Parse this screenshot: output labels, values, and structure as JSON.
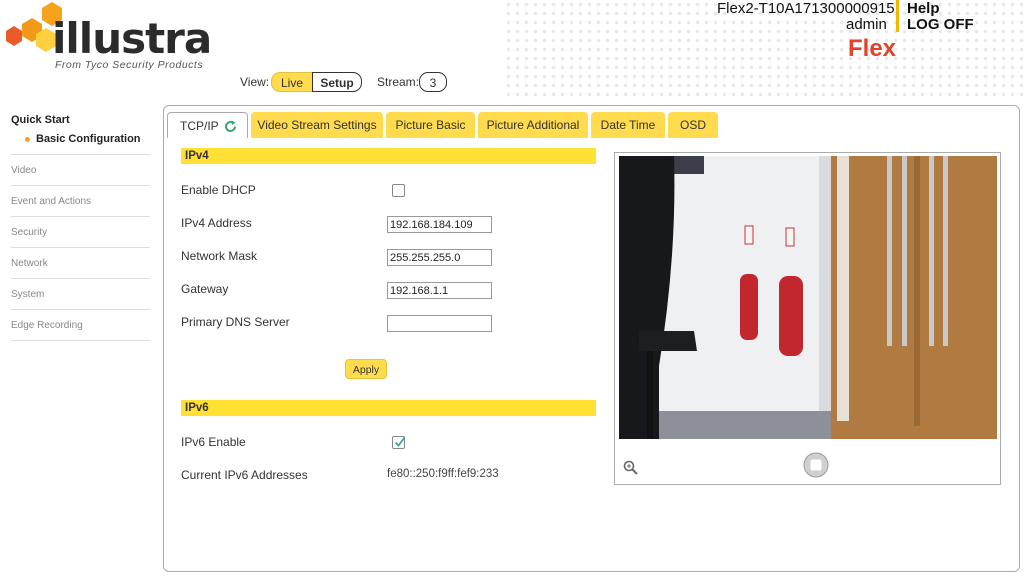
{
  "brand": {
    "logo_text": "illustra",
    "logo_sub": "From Tyco Security Products",
    "product": "Flex"
  },
  "header": {
    "device_name": "Flex2-T10A171300000915",
    "user": "admin",
    "help": "Help",
    "logoff": "LOG OFF"
  },
  "view": {
    "label": "View:",
    "live": "Live",
    "setup": "Setup",
    "stream_label": "Stream:",
    "stream_value": "3"
  },
  "sidebar": {
    "title": "Quick Start",
    "sub": "Basic Configuration",
    "items": [
      "Video",
      "Event and Actions",
      "Security",
      "Network",
      "System",
      "Edge Recording"
    ]
  },
  "tabs": [
    "TCP/IP",
    "Video Stream Settings",
    "Picture Basic",
    "Picture Additional",
    "Date Time",
    "OSD"
  ],
  "ipv4": {
    "header": "IPv4",
    "dhcp_label": "Enable DHCP",
    "dhcp_checked": false,
    "address_label": "IPv4 Address",
    "address": "192.168.184.109",
    "mask_label": "Network Mask",
    "mask": "255.255.255.0",
    "gateway_label": "Gateway",
    "gateway": "192.168.1.1",
    "dns_label": "Primary DNS Server",
    "dns": "",
    "apply": "Apply"
  },
  "ipv6": {
    "header": "IPv6",
    "enable_label": "IPv6 Enable",
    "enable_checked": true,
    "addresses_label": "Current IPv6 Addresses",
    "addresses": "fe80::250:f9ff:fef9:233"
  },
  "icons": {
    "refresh": "refresh-icon",
    "zoom": "magnifier-icon",
    "stop": "stop-icon"
  },
  "colors": {
    "accent": "#ffdb4d",
    "brand_red": "#e0432a",
    "refresh_green": "#3aa76d"
  }
}
